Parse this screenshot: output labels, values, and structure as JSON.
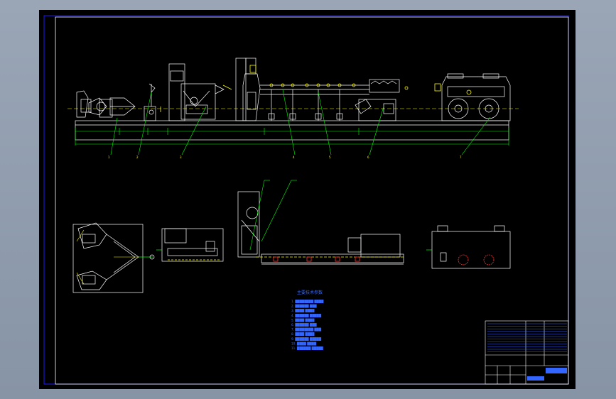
{
  "viewport": {
    "background": "#8e9aab",
    "sheet_color": "#000000"
  },
  "drawing": {
    "frame_color": "#1a1aff",
    "line_colors": {
      "outline": "#ffffff",
      "dimension": "#00ff00",
      "centerline": "#ffff00",
      "hidden": "#ff3333",
      "annotation": "#3333ff",
      "grid": "#ffffff"
    },
    "top_view": {
      "callout_count": 7
    },
    "bottom_views": {
      "view_count": 5
    },
    "notes": {
      "title": "主要技术参数",
      "lines": [
        "1. ████████ ████",
        "2. ██████ ███",
        "3. ████ ████",
        "4. ██████ █████",
        "5. ████ ████",
        "6. ██████ ███",
        "7. ████████ ███",
        "8. ████ ████",
        "9. ██████ █████",
        "10. ████ ████",
        "11. ██████ █████"
      ]
    },
    "title_block": {
      "rows": 12
    }
  }
}
